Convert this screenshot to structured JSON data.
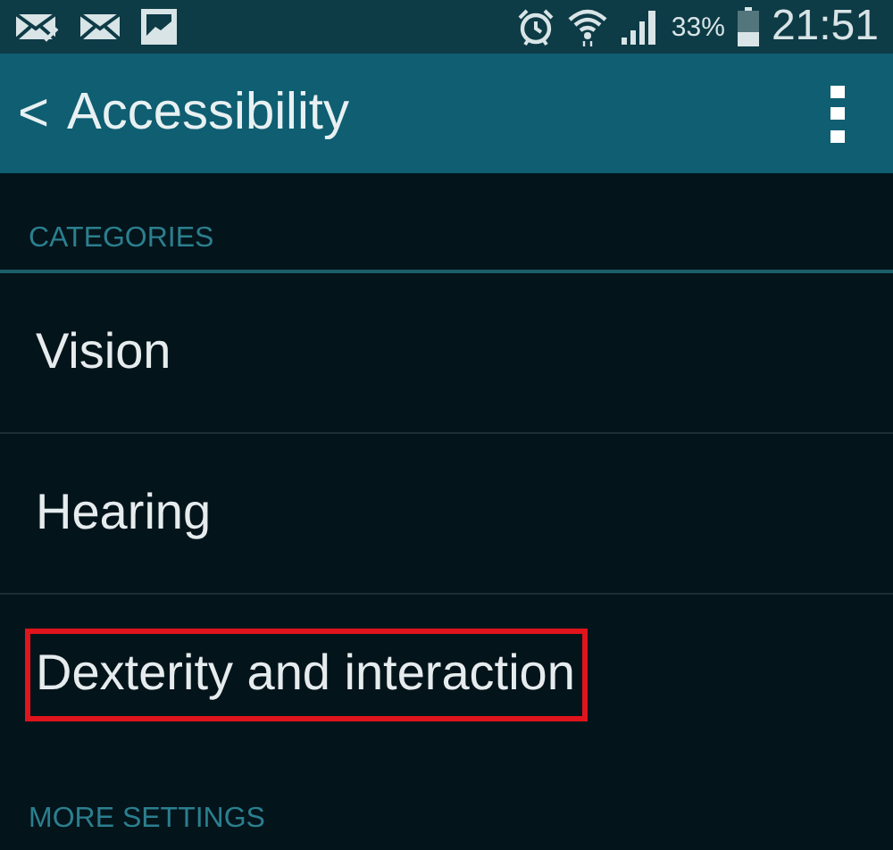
{
  "status_bar": {
    "battery_percent": "33%",
    "time": "21:51"
  },
  "app_bar": {
    "back": "<",
    "title": "Accessibility"
  },
  "sections": [
    {
      "header": "CATEGORIES",
      "items": [
        {
          "label": "Vision",
          "highlighted": false
        },
        {
          "label": "Hearing",
          "highlighted": false
        },
        {
          "label": "Dexterity and interaction",
          "highlighted": true
        }
      ]
    },
    {
      "header": "MORE SETTINGS"
    }
  ]
}
